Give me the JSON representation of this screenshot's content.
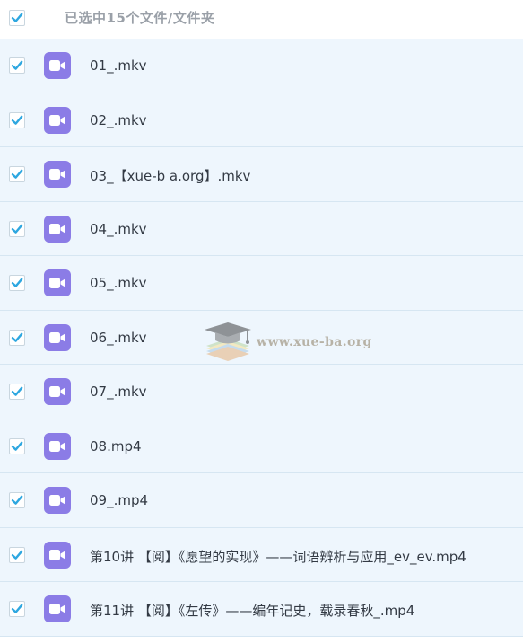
{
  "header": {
    "select_all_checked": true,
    "title": "已选中15个文件/文件夹"
  },
  "accent_color": "#2ea7e0",
  "file_icon": {
    "name": "video-file-icon",
    "color": "#8b7ce6"
  },
  "files": [
    {
      "name": "01_.mkv",
      "checked": true
    },
    {
      "name": "02_.mkv",
      "checked": true
    },
    {
      "name": "03_【xue-b a.org】.mkv",
      "checked": true
    },
    {
      "name": "04_.mkv",
      "checked": true
    },
    {
      "name": "05_.mkv",
      "checked": true
    },
    {
      "name": "06_.mkv",
      "checked": true
    },
    {
      "name": "07_.mkv",
      "checked": true
    },
    {
      "name": "08.mp4",
      "checked": true
    },
    {
      "name": "09_.mp4",
      "checked": true
    },
    {
      "name": "第10讲 【阅】《愿望的实现》——词语辨析与应用_ev_ev.mp4",
      "checked": true
    },
    {
      "name": "第11讲 【阅】《左传》——编年记史，载录春秋_.mp4",
      "checked": true
    }
  ],
  "watermark": {
    "text": "www.xue-ba.org"
  }
}
